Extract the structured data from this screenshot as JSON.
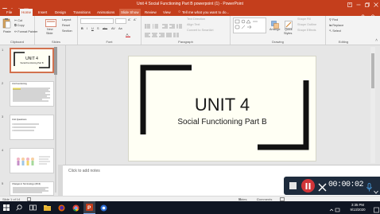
{
  "window": {
    "title": "Unit 4 Social Functioning Part B powerpoint (1) - PowerPoint",
    "controls": [
      "ribbon-options",
      "minimize",
      "restore",
      "close"
    ]
  },
  "ribbon_tabs": [
    "File",
    "Home",
    "Insert",
    "Design",
    "Transitions",
    "Animations",
    "Slide Show",
    "Review",
    "View"
  ],
  "tell_me": "Tell me what you want to do...",
  "ribbon": {
    "clipboard": {
      "paste": "Paste",
      "cut": "Cut",
      "copy": "Copy",
      "format_painter": "Format Painter",
      "label": "Clipboard"
    },
    "slides": {
      "new_slide_line1": "New",
      "new_slide_line2": "Slide",
      "layout": "Layout",
      "reset": "Reset",
      "section": "Section",
      "label": "Slides"
    },
    "font": {
      "label": "Font"
    },
    "paragraph": {
      "text_direction": "Text Direction",
      "align_text": "Align Text",
      "smartart": "Convert to SmartArt",
      "label": "Paragraph"
    },
    "drawing": {
      "arrange": "Arrange",
      "quick_styles_line1": "Quick",
      "quick_styles_line2": "Styles",
      "shape_fill": "Shape Fill",
      "shape_outline": "Shape Outline",
      "shape_effects": "Shape Effects",
      "label": "Drawing"
    },
    "editing": {
      "find": "Find",
      "replace": "Replace",
      "select": "Select",
      "label": "Editing"
    }
  },
  "thumbnails": [
    {
      "number": "1",
      "title": "UNIT 4",
      "subtitle": "Social Functioning Part B",
      "selected": true
    },
    {
      "number": "2",
      "title": "Unit Functioning",
      "selected": false
    },
    {
      "number": "3",
      "title": "Unit Questions",
      "selected": false
    },
    {
      "number": "4",
      "title": "",
      "selected": false
    },
    {
      "number": "5",
      "title": "Changes in Terminology (2013)",
      "selected": false
    }
  ],
  "slide": {
    "title": "UNIT 4",
    "subtitle": "Social Functioning Part B"
  },
  "notes_placeholder": "Click to add notes",
  "status": {
    "slide_counter": "Slide 1 of 14",
    "notes": "Notes",
    "comments": "Comments"
  },
  "recorder": {
    "time": "00:00:02"
  },
  "taskbar": {
    "time": "3:35 PM",
    "date": "9/13/2020"
  },
  "colors": {
    "accent": "#c43e1c",
    "slide_bg": "#fffff4",
    "taskbar": "#101623",
    "recorder_bg": "#1e2b3c",
    "record_red": "#d13438"
  }
}
